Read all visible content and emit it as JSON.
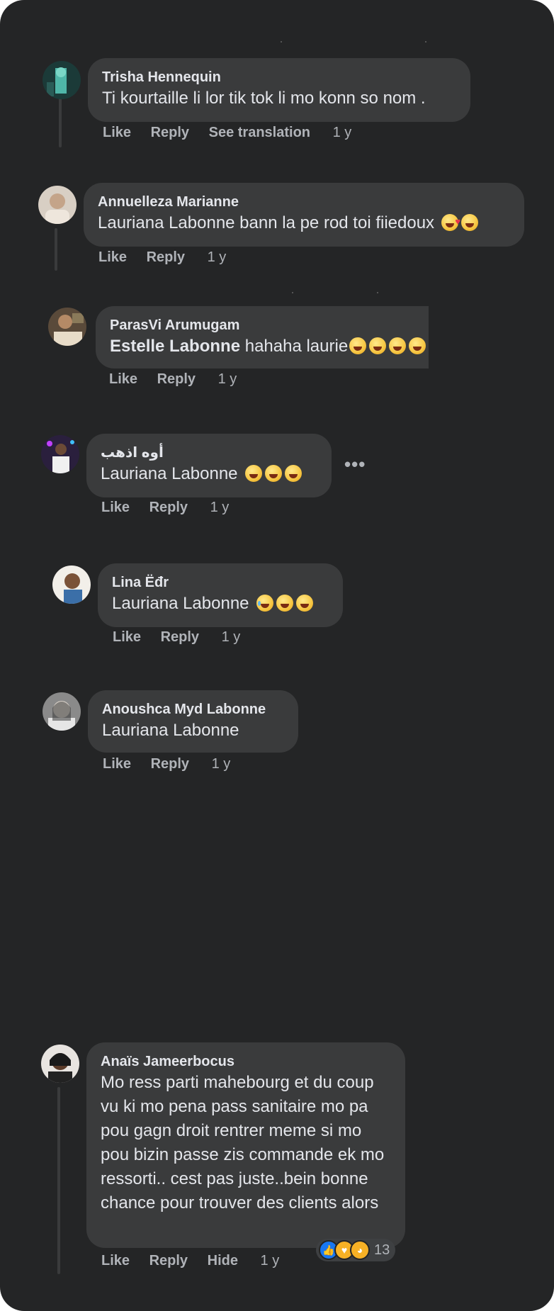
{
  "comments": [
    {
      "author": "Trisha Hennequin",
      "text": "Ti kourtaille li lor tik tok li mo konn so nom .",
      "actions": [
        "Like",
        "Reply",
        "See translation"
      ],
      "time": "1 y"
    },
    {
      "author": "Annuelleza Marianne",
      "text": "Lauriana Labonne bann la pe rod toi fiiedoux",
      "actions": [
        "Like",
        "Reply"
      ],
      "time": "1 y"
    },
    {
      "author": "ParasVi Arumugam",
      "mention": "Estelle Labonne",
      "text": " hahaha laurie",
      "actions": [
        "Like",
        "Reply"
      ],
      "time": "1 y"
    },
    {
      "author": "أوه اذهب",
      "text": "Lauriana Labonne",
      "actions": [
        "Like",
        "Reply"
      ],
      "time": "1 y",
      "more": "•••"
    },
    {
      "author": "Lina Ëđr",
      "text": "Lauriana Labonne",
      "actions": [
        "Like",
        "Reply"
      ],
      "time": "1 y"
    },
    {
      "author": "Anoushca Myd Labonne",
      "text": "Lauriana Labonne",
      "actions": [
        "Like",
        "Reply"
      ],
      "time": "1 y"
    },
    {
      "author": "Anaïs Jameerbocus",
      "text": "Mo ress parti mahebourg et du coup vu ki mo pena pass sanitaire mo pa pou gagn droit rentrer meme si mo pou bizin passe zis commande ek mo ressorti.. cest pas juste..bein bonne chance pour trouver des clients alors",
      "actions": [
        "Like",
        "Reply",
        "Hide"
      ],
      "time": "1 y",
      "reactions": {
        "types": [
          "like-icon",
          "care-icon",
          "haha-icon"
        ],
        "count": "13"
      }
    }
  ],
  "colors": {
    "background": "#242526",
    "bubble": "#3a3b3c",
    "text": "#e4e6eb",
    "muted": "#b0b3b8",
    "like": "#1877f2"
  }
}
